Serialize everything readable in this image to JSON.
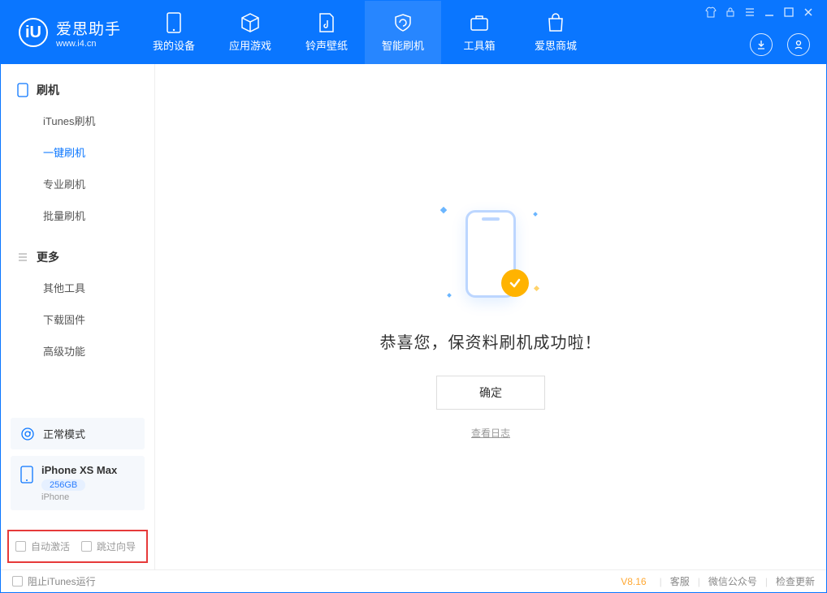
{
  "brand": {
    "name": "爱思助手",
    "url": "www.i4.cn",
    "logo_letter": "iU"
  },
  "nav": [
    {
      "label": "我的设备"
    },
    {
      "label": "应用游戏"
    },
    {
      "label": "铃声壁纸"
    },
    {
      "label": "智能刷机"
    },
    {
      "label": "工具箱"
    },
    {
      "label": "爱思商城"
    }
  ],
  "sidebar": {
    "group1": {
      "title": "刷机",
      "items": [
        "iTunes刷机",
        "一键刷机",
        "专业刷机",
        "批量刷机"
      ]
    },
    "group2": {
      "title": "更多",
      "items": [
        "其他工具",
        "下载固件",
        "高级功能"
      ]
    }
  },
  "device_mode": {
    "label": "正常模式"
  },
  "device_info": {
    "name": "iPhone XS Max",
    "storage": "256GB",
    "type": "iPhone"
  },
  "options": {
    "auto_activate": "自动激活",
    "skip_guide": "跳过向导"
  },
  "main": {
    "success_text": "恭喜您，保资料刷机成功啦！",
    "ok_button": "确定",
    "log_link": "查看日志"
  },
  "footer": {
    "block_itunes": "阻止iTunes运行",
    "version": "V8.16",
    "links": [
      "客服",
      "微信公众号",
      "检查更新"
    ]
  }
}
